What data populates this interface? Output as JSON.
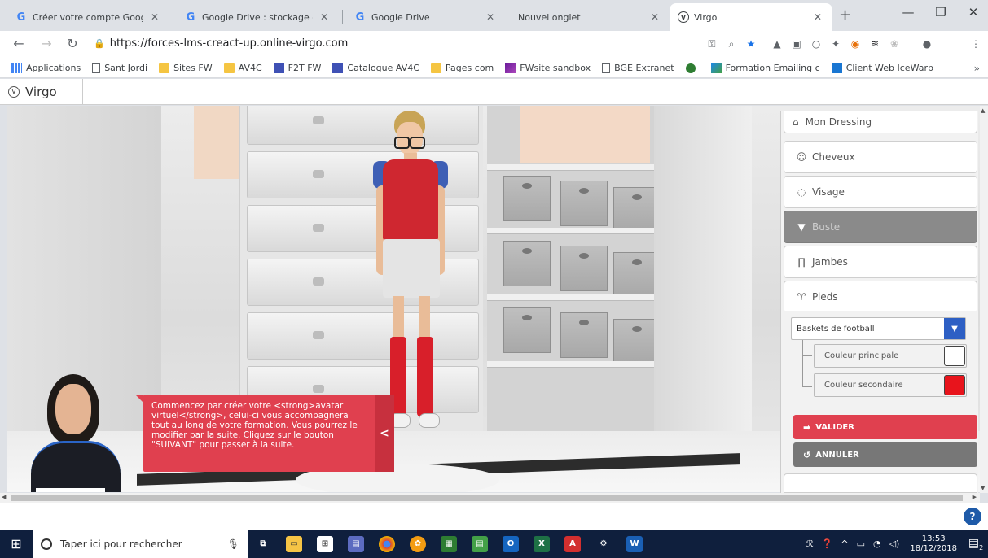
{
  "browser": {
    "tabs": [
      {
        "title": "Créer votre compte Google",
        "icon": "google-g-icon",
        "active": false
      },
      {
        "title": "Google Drive : stockage de fich",
        "icon": "google-g-icon",
        "active": false
      },
      {
        "title": "Google Drive",
        "icon": "google-g-icon",
        "active": false
      },
      {
        "title": "Nouvel onglet",
        "icon": "",
        "active": false
      },
      {
        "title": "Virgo",
        "icon": "virgo-icon",
        "active": true
      }
    ],
    "url": "https://forces-lms-creact-up.online-virgo.com",
    "bookmarks": [
      {
        "label": "Applications",
        "icon": "apps-grid-icon"
      },
      {
        "label": "Sant Jordi",
        "icon": "page-icon"
      },
      {
        "label": "Sites FW",
        "icon": "folder-icon"
      },
      {
        "label": "AV4C",
        "icon": "folder-icon"
      },
      {
        "label": "F2T FW",
        "icon": "list-icon"
      },
      {
        "label": "Catalogue AV4C",
        "icon": "list-icon"
      },
      {
        "label": "Pages com",
        "icon": "folder-icon"
      },
      {
        "label": "FWsite sandbox",
        "icon": "sandbox-icon"
      },
      {
        "label": "BGE Extranet",
        "icon": "page-icon"
      },
      {
        "label": "",
        "icon": "circle-icon"
      },
      {
        "label": "Formation Emailing c",
        "icon": "mail-icon"
      },
      {
        "label": "Client Web IceWarp",
        "icon": "icewarp-icon"
      }
    ],
    "bookmarks_more": "»"
  },
  "app": {
    "brand": "Virgo",
    "bubble_text": "Commencez par créer votre <strong>avatar virtuel</strong>, celui-ci vous accompagnera tout au long de votre formation. Vous pourrez le modifier par la suite. Cliquez sur le bouton \"SUIVANT\" pour passer à la suite.",
    "bubble_toggle": "<",
    "panel": {
      "title": "Mon Dressing",
      "categories": [
        {
          "label": "Cheveux",
          "icon": "hair-icon",
          "active": false
        },
        {
          "label": "Visage",
          "icon": "face-icon",
          "active": false
        },
        {
          "label": "Buste",
          "icon": "tshirt-icon",
          "active": true
        },
        {
          "label": "Jambes",
          "icon": "pants-icon",
          "active": false
        },
        {
          "label": "Pieds",
          "icon": "feet-icon",
          "active": false
        }
      ],
      "shoe_select": "Baskets de football",
      "colors": [
        {
          "label": "Couleur principale",
          "value": "#ffffff"
        },
        {
          "label": "Couleur secondaire",
          "value": "#e8141c"
        }
      ],
      "validate_label": "VALIDER",
      "cancel_label": "ANNULER"
    }
  },
  "taskbar": {
    "search_placeholder": "Taper ici pour rechercher",
    "time": "13:53",
    "date": "18/12/2018",
    "notification_count": "2"
  },
  "colors": {
    "accent_red": "#e0404f",
    "select_blue": "#2d5fc4",
    "taskbar": "#0f1f3d"
  }
}
